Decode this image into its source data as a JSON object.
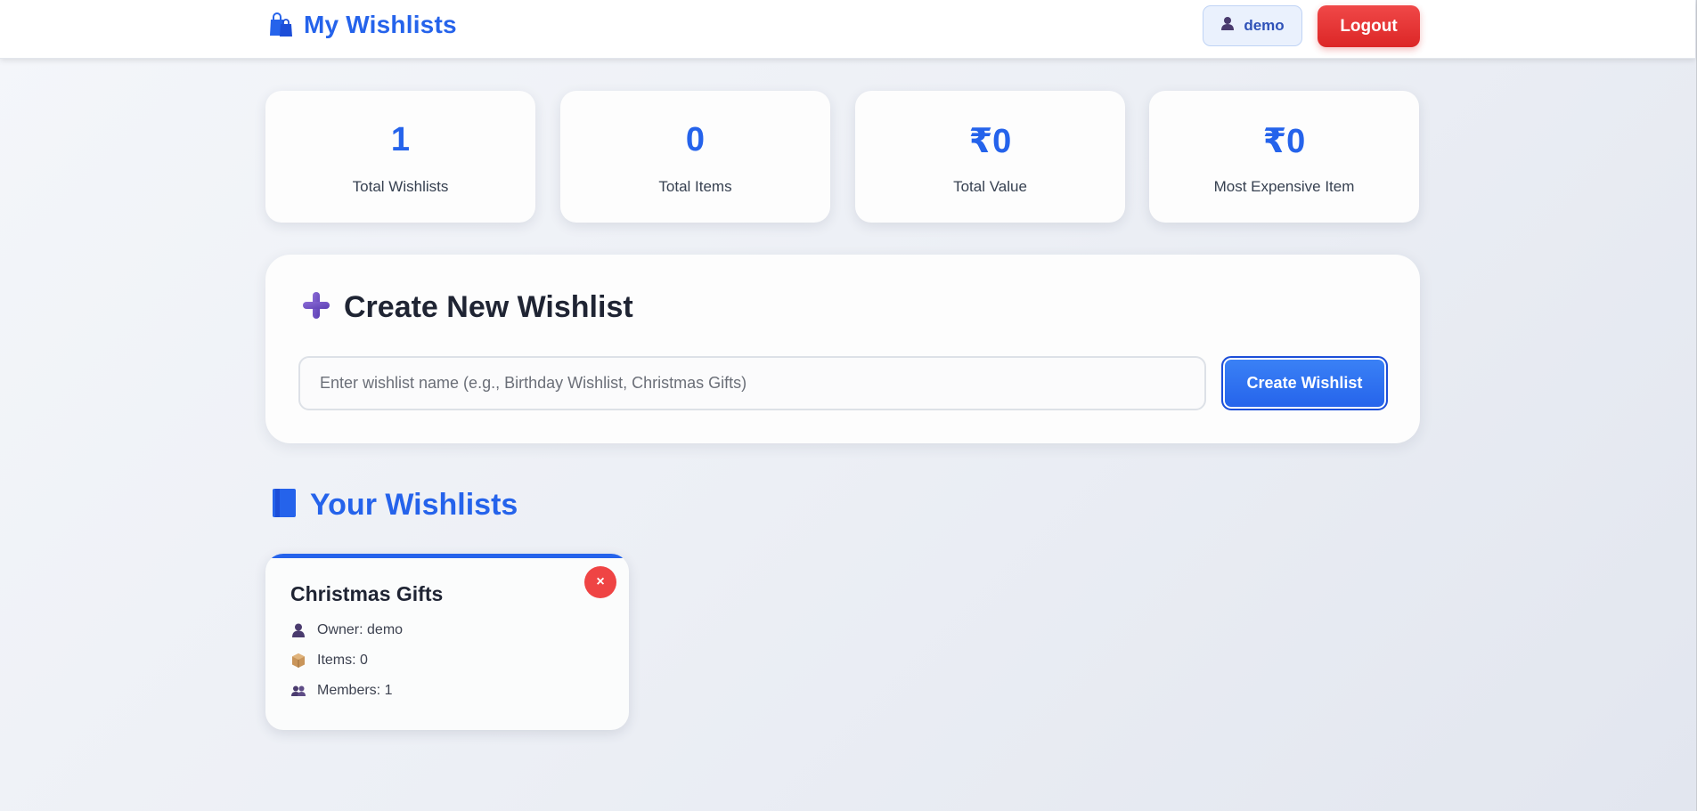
{
  "header": {
    "app_title": "My Wishlists",
    "user_name": "demo",
    "logout_label": "Logout"
  },
  "stats": [
    {
      "value": "1",
      "label": "Total Wishlists"
    },
    {
      "value": "0",
      "label": "Total Items"
    },
    {
      "value": "₹0",
      "label": "Total Value"
    },
    {
      "value": "₹0",
      "label": "Most Expensive Item"
    }
  ],
  "create": {
    "title": "Create New Wishlist",
    "input_placeholder": "Enter wishlist name (e.g., Birthday Wishlist, Christmas Gifts)",
    "input_value": "",
    "button_label": "Create Wishlist"
  },
  "wishlists_section": {
    "title": "Your Wishlists",
    "items": [
      {
        "name": "Christmas Gifts",
        "delete_label": "×",
        "owner_text": "Owner: demo",
        "items_text": "Items: 0",
        "members_text": "Members: 1"
      }
    ]
  },
  "colors": {
    "accent": "#2563eb",
    "danger": "#ef4444",
    "text_dark": "#1f2433",
    "text_muted": "#374151"
  },
  "icons": {
    "brand": "shopping-bags-icon",
    "user": "user-silhouette-icon",
    "plus": "plus-icon",
    "section": "bookmark-icon",
    "owner": "user-silhouette-icon",
    "items": "package-box-icon",
    "members": "two-users-icon",
    "delete": "close-icon"
  }
}
